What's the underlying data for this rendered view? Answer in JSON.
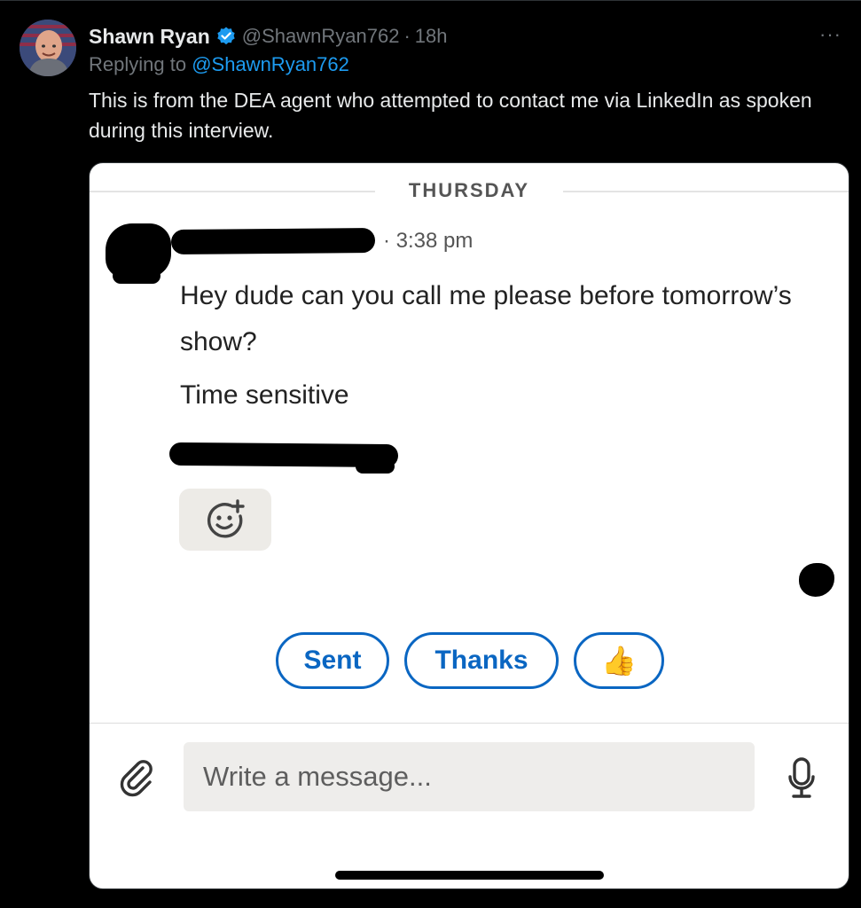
{
  "tweet": {
    "author_name": "Shawn Ryan",
    "verified_icon": "verified-badge-icon",
    "handle": "@ShawnRyan762",
    "separator": "·",
    "time": "18h",
    "more_label": "···",
    "replying_prefix": "Replying to",
    "replying_to": "@ShawnRyan762",
    "text": "This is from the DEA agent who attempted to contact me via LinkedIn as spoken during this interview."
  },
  "screenshot": {
    "day_label": "THURSDAY",
    "message_time": "· 3:38 pm",
    "message_line1": "Hey dude can you call me please before tomorrow’s show?",
    "message_line2": "Time sensitive",
    "reaction_icon": "add-reaction-icon",
    "quick_replies": [
      "Sent",
      "Thanks"
    ],
    "quick_reply_emoji": "👍",
    "compose_placeholder": "Write a message...",
    "attach_icon": "paperclip-icon",
    "mic_icon": "microphone-icon",
    "colors": {
      "linkedin_blue": "#0a66c2",
      "twitter_blue": "#1d9bf0",
      "muted": "#71767b"
    }
  }
}
